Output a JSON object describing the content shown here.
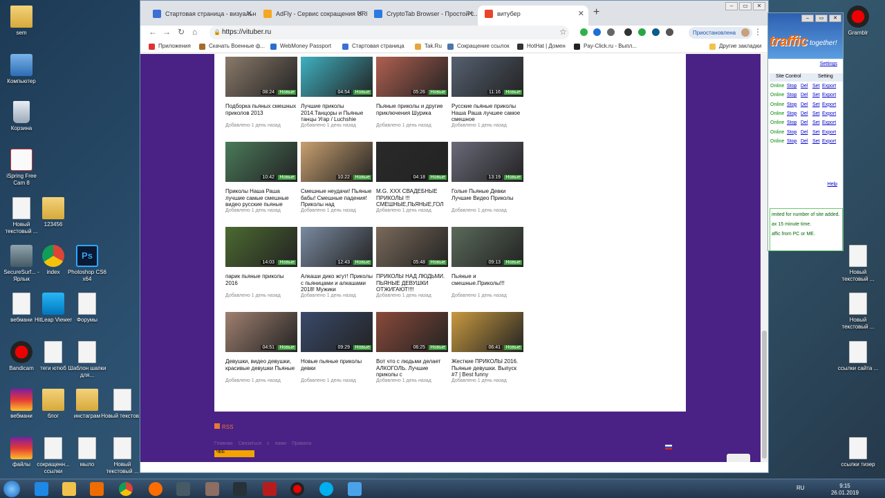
{
  "desktop": {
    "left_icons": [
      {
        "label": "sem",
        "kind": "folder"
      },
      {
        "label": "Компьютер",
        "kind": "pc"
      },
      {
        "label": "Корзина",
        "kind": "bin"
      },
      {
        "label": "iSpring Free Cam 8",
        "kind": "ispring"
      },
      {
        "label": "Новый текстовый ...",
        "kind": "file"
      },
      {
        "label": "123456",
        "kind": "folder"
      },
      {
        "label": "SecureSurf... - Ярлык",
        "kind": "secure"
      },
      {
        "label": "index",
        "kind": "chrome"
      },
      {
        "label": "Photoshop CS6 x64",
        "kind": "ps"
      },
      {
        "label": "вебмани",
        "kind": "file"
      },
      {
        "label": "HitLeap Viewer",
        "kind": "hitleap"
      },
      {
        "label": "Форумы",
        "kind": "file"
      },
      {
        "label": "Bandicam",
        "kind": "rec"
      },
      {
        "label": "теги ютюб",
        "kind": "file"
      },
      {
        "label": "Шаблон шапки для...",
        "kind": "file"
      },
      {
        "label": "вебмани",
        "kind": "winrar"
      },
      {
        "label": "блог",
        "kind": "folder"
      },
      {
        "label": "инстаграм",
        "kind": "folder"
      },
      {
        "label": "Новый текстов...",
        "kind": "file"
      },
      {
        "label": "файлы",
        "kind": "winrar"
      },
      {
        "label": "сокращенн... ссылки",
        "kind": "file"
      },
      {
        "label": "мыло",
        "kind": "file"
      },
      {
        "label": "Новый текстовый ...",
        "kind": "file"
      }
    ],
    "right_icons": [
      {
        "label": "Gramblr",
        "kind": "rec"
      },
      {
        "label": "Новый текстовый ...",
        "kind": "file"
      },
      {
        "label": "Новый текстовый ...",
        "kind": "file"
      },
      {
        "label": "ссылки сайта ...",
        "kind": "file"
      },
      {
        "label": "ссылки тизер",
        "kind": "file"
      }
    ]
  },
  "browser": {
    "tabs": [
      {
        "title": "Стартовая страница - визуальн...",
        "color": "#3b6fd4"
      },
      {
        "title": "AdFly - Сервис сокращения URL...",
        "color": "#f5a623"
      },
      {
        "title": "CryptoTab Browser - Простой с...",
        "color": "#2a7ae2"
      },
      {
        "title": "витубер",
        "color": "#e8452c"
      }
    ],
    "url": "https://vituber.ru",
    "profile_status": "Приостановлена",
    "bookmarks": [
      {
        "label": "Приложения",
        "color": "#d33"
      },
      {
        "label": "Скачать Военные ф...",
        "color": "#a66b2b"
      },
      {
        "label": "WebMoney Passport",
        "color": "#2b6fd0"
      },
      {
        "label": "Стартовая страница",
        "color": "#3b6fd4"
      },
      {
        "label": "Tak.Ru",
        "color": "#e9a43a"
      },
      {
        "label": "Сокращение ссылок",
        "color": "#4a76a8"
      },
      {
        "label": "HotHat | Домен",
        "color": "#333"
      },
      {
        "label": "Pay-Click.ru - Выпл...",
        "color": "#222"
      }
    ],
    "other_bookmarks": "Другие закладки"
  },
  "videos": [
    {
      "title": "Подборка пьяных смешных приколов 2013",
      "duration": "08:24",
      "date": "Добавлено 1 день назад",
      "badge": "Новые",
      "tint": "#8a7a6a"
    },
    {
      "title": "Лучшие приколы 2014.Танцоры и Пьяные танцы Угар / Luchshie",
      "duration": "04:54",
      "date": "Добавлено 1 день назад",
      "badge": "Новые",
      "tint": "#3fb0c0"
    },
    {
      "title": "Пьяные приколы и другие приключения Шурика",
      "duration": "05:26",
      "date": "Добавлено 1 день назад",
      "badge": "Новые",
      "tint": "#b06050"
    },
    {
      "title": "Русские пьяные приколы Наша Раша лучшее самое смешное",
      "duration": "11:16",
      "date": "Добавлено 1 день назад",
      "badge": "Новые",
      "tint": "#556070"
    },
    {
      "title": "Приколы Наша Раша лучшие самые смешные видео русские пьяные",
      "duration": "10:42",
      "date": "Добавлено 1 день назад",
      "badge": "Новые",
      "tint": "#4a7a5a"
    },
    {
      "title": "Смешные неудачи! Пьяные бабы! Смешные падения! Приколы над",
      "duration": "10:22",
      "date": "Добавлено 1 день назад",
      "badge": "Новые",
      "tint": "#c8a070"
    },
    {
      "title": "M.G. XXX СВАДЕБНЫЕ ПРИКОЛЫ !!! СМЕШНЫЕ,ПЬЯНЫЕ,ГОЛ",
      "duration": "04:18",
      "date": "Добавлено 1 день назад",
      "badge": "Новые",
      "tint": "#2a2a2a"
    },
    {
      "title": "Голые Пьяные Девки Лучшие Видео Приколы",
      "duration": "13:19",
      "date": "Добавлено 1 день назад",
      "badge": "Новые",
      "tint": "#6a6a7a"
    },
    {
      "title": "парик пьяные приколы 2016",
      "duration": "14:03",
      "date": "Добавлено 1 день назад",
      "badge": "Новые",
      "tint": "#4c6a30"
    },
    {
      "title": "Алкаши дико жгут! Приколы с пьяницами и алкашами 2018! Мужики",
      "duration": "12:43",
      "date": "Добавлено 1 день назад",
      "badge": "Новые",
      "tint": "#7a8aa0"
    },
    {
      "title": "ПРИКОЛЫ НАД ЛЮДЬМИ. ПЬЯНЫЕ ДЕВУШКИ ОТЖИГАЮТ!!!!",
      "duration": "05:48",
      "date": "Добавлено 1 день назад",
      "badge": "Новые",
      "tint": "#7a6a5a"
    },
    {
      "title": "Пьяные и смешные.Приколы!!!",
      "duration": "09:13",
      "date": "Добавлено 1 день назад",
      "badge": "Новые",
      "tint": "#5a6a5a"
    },
    {
      "title": "Девушки, видео девушки, красивые девушки Пьяные",
      "duration": "04:51",
      "date": "Добавлено 1 день назад",
      "badge": "Новые",
      "tint": "#a08070"
    },
    {
      "title": "Новые пьяные приколы девки",
      "duration": "09:29",
      "date": "Добавлено 1 день назад",
      "badge": "Новые",
      "tint": "#3a4a6a"
    },
    {
      "title": "Вот что с людьми делает АЛКОГОЛЬ. Лучшие приколы с",
      "duration": "06:25",
      "date": "Добавлено 1 день назад",
      "badge": "Новые",
      "tint": "#8a4a3a"
    },
    {
      "title": "Жесткие ПРИКОЛЫ 2016. Пьяные девушки. Выпуск #7 | Best funny",
      "duration": "06:41",
      "date": "Добавлено 1 день назад",
      "badge": "Новые",
      "tint": "#c89a40"
    }
  ],
  "footer": {
    "rss": "RSS",
    "links": "Главная  Связаться с нами  Правила",
    "counter": "ЧЕБ"
  },
  "traffic_window": {
    "logo": "traffic",
    "logo_tail": "together!",
    "settings": "Settings",
    "col_site": "Site Control",
    "col_setting": "Setting",
    "row_status": "Online",
    "row_stop": "Stop",
    "row_del": "Del",
    "row_set": "Set",
    "row_export": "Export",
    "rows": 7,
    "help": "Help",
    "notes": [
      "imited for number of site added.",
      "ax 15 minute time.",
      "affic from PC or ME."
    ]
  },
  "taskbar": {
    "lang": "RU",
    "time": "9:15",
    "date": "26.01.2019"
  }
}
